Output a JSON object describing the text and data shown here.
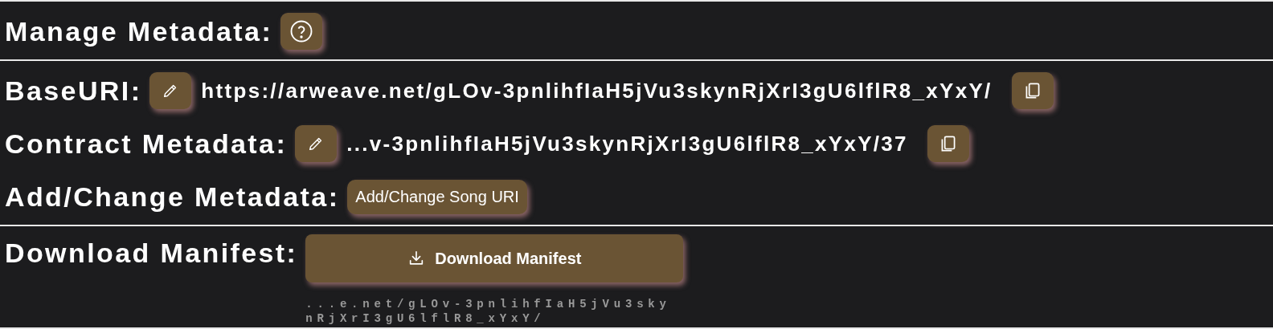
{
  "sections": [
    {
      "rows": [
        {
          "kind": "help",
          "label": "Manage Metadata:"
        }
      ]
    },
    {
      "rows": [
        {
          "kind": "uri",
          "label": "BaseURI:",
          "value": "https://arweave.net/gLOv-3pnlihfIaH5jVu3skynRjXrI3gU6lflR8_xYxY/"
        },
        {
          "kind": "uri",
          "label": "Contract Metadata:",
          "value": "...v-3pnlihfIaH5jVu3skynRjXrI3gU6lflR8_xYxY/37"
        },
        {
          "kind": "action",
          "label": "Add/Change Metadata:",
          "button": "Add/Change Song URI"
        }
      ]
    },
    {
      "rows": [
        {
          "kind": "download",
          "label": "Download Manifest:",
          "button": "Download Manifest",
          "note": "...e.net/gLOv-3pnlihfIaH5jVu3skynRjXrI3gU6lflR8_xYxY/"
        }
      ]
    }
  ]
}
